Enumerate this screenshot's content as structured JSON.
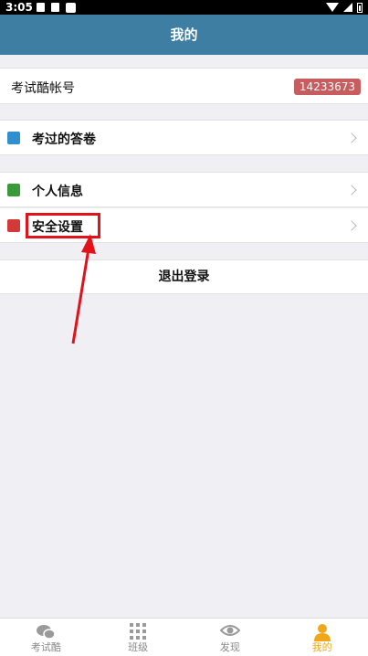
{
  "status_bar": {
    "time": "3:05"
  },
  "header": {
    "title": "我的"
  },
  "account": {
    "label": "考试酷帐号",
    "id": "14233673"
  },
  "menu": {
    "answered_papers": "考过的答卷",
    "personal_info": "个人信息",
    "security_settings": "安全设置",
    "logout": "退出登录"
  },
  "tabbar": {
    "tabs": [
      {
        "label": "考试酷",
        "icon": "chat-bubbles-icon",
        "active": false
      },
      {
        "label": "班级",
        "icon": "grid-icon",
        "active": false
      },
      {
        "label": "发现",
        "icon": "eye-icon",
        "active": false
      },
      {
        "label": "我的",
        "icon": "person-icon",
        "active": true
      }
    ]
  },
  "colors": {
    "header": "#3f7ea3",
    "badge": "#c75d5f",
    "highlight": "#e1121a",
    "active_tab": "#f0a81a"
  }
}
